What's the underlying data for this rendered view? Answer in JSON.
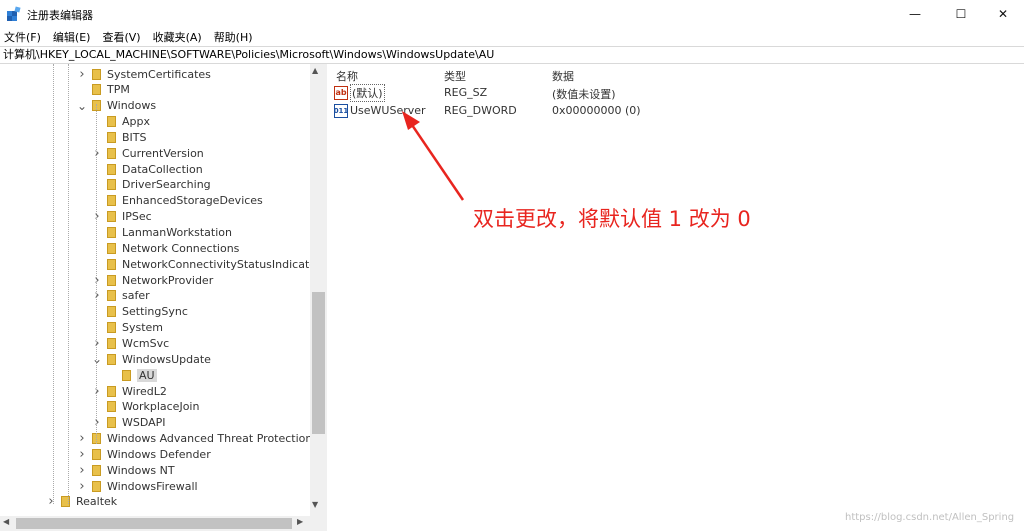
{
  "window": {
    "title": "注册表编辑器",
    "min_icon": "—",
    "max_icon": "☐",
    "close_icon": "✕"
  },
  "menu": [
    "文件(F)",
    "编辑(E)",
    "查看(V)",
    "收藏夹(A)",
    "帮助(H)"
  ],
  "address": "计算机\\HKEY_LOCAL_MACHINE\\SOFTWARE\\Policies\\Microsoft\\Windows\\WindowsUpdate\\AU",
  "tree": [
    {
      "label": "SystemCertificates",
      "level": 2,
      "expander": "collapsed"
    },
    {
      "label": "TPM",
      "level": 2,
      "expander": "none"
    },
    {
      "label": "Windows",
      "level": 2,
      "expander": "expanded"
    },
    {
      "label": "Appx",
      "level": 3,
      "expander": "none"
    },
    {
      "label": "BITS",
      "level": 3,
      "expander": "none"
    },
    {
      "label": "CurrentVersion",
      "level": 3,
      "expander": "collapsed"
    },
    {
      "label": "DataCollection",
      "level": 3,
      "expander": "none"
    },
    {
      "label": "DriverSearching",
      "level": 3,
      "expander": "none"
    },
    {
      "label": "EnhancedStorageDevices",
      "level": 3,
      "expander": "none"
    },
    {
      "label": "IPSec",
      "level": 3,
      "expander": "collapsed"
    },
    {
      "label": "LanmanWorkstation",
      "level": 3,
      "expander": "none"
    },
    {
      "label": "Network Connections",
      "level": 3,
      "expander": "none"
    },
    {
      "label": "NetworkConnectivityStatusIndicator",
      "level": 3,
      "expander": "none"
    },
    {
      "label": "NetworkProvider",
      "level": 3,
      "expander": "collapsed"
    },
    {
      "label": "safer",
      "level": 3,
      "expander": "collapsed"
    },
    {
      "label": "SettingSync",
      "level": 3,
      "expander": "none"
    },
    {
      "label": "System",
      "level": 3,
      "expander": "none"
    },
    {
      "label": "WcmSvc",
      "level": 3,
      "expander": "collapsed"
    },
    {
      "label": "WindowsUpdate",
      "level": 3,
      "expander": "expanded"
    },
    {
      "label": "AU",
      "level": 4,
      "expander": "none",
      "selected": true
    },
    {
      "label": "WiredL2",
      "level": 3,
      "expander": "collapsed"
    },
    {
      "label": "WorkplaceJoin",
      "level": 3,
      "expander": "none"
    },
    {
      "label": "WSDAPI",
      "level": 3,
      "expander": "collapsed"
    },
    {
      "label": "Windows Advanced Threat Protection",
      "level": 2,
      "expander": "collapsed"
    },
    {
      "label": "Windows Defender",
      "level": 2,
      "expander": "collapsed"
    },
    {
      "label": "Windows NT",
      "level": 2,
      "expander": "collapsed"
    },
    {
      "label": "WindowsFirewall",
      "level": 2,
      "expander": "collapsed"
    },
    {
      "label": "Realtek",
      "level": 1,
      "expander": "collapsed"
    }
  ],
  "columns": {
    "name": "名称",
    "type": "类型",
    "data": "数据"
  },
  "values": [
    {
      "name": "(默认)",
      "type": "REG_SZ",
      "data": "(数值未设置)",
      "icon": "ab"
    },
    {
      "name": "UseWUServer",
      "type": "REG_DWORD",
      "data": "0x00000000 (0)",
      "icon": "011"
    }
  ],
  "annotation": "双击更改，将默认值 1 改为 0",
  "annotation_color": "#e8251f",
  "watermark": "https://blog.csdn.net/Allen_Spring"
}
